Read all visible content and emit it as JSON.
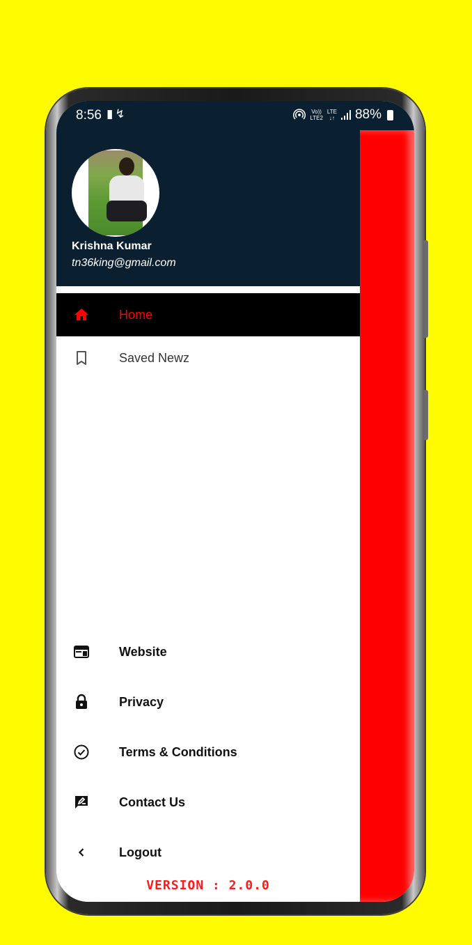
{
  "status_bar": {
    "time": "8:56",
    "left_icons": [
      "sim-icon",
      "bolt-icon"
    ],
    "volte_label_top": "Vo))",
    "volte_label_bottom": "LTE2",
    "lte_label_top": "LTE",
    "lte_label_bottom": "↓↑",
    "battery": "88%"
  },
  "profile": {
    "name": "Krishna Kumar",
    "email": "tn36king@gmail.com"
  },
  "menu": {
    "home": {
      "label": "Home",
      "icon": "home-icon"
    },
    "saved": {
      "label": "Saved Newz",
      "icon": "bookmark-icon"
    },
    "website": {
      "label": "Website",
      "icon": "web-icon"
    },
    "privacy": {
      "label": "Privacy",
      "icon": "lock-icon"
    },
    "terms": {
      "label": "Terms & Conditions",
      "icon": "check-circle-icon"
    },
    "contact": {
      "label": "Contact Us",
      "icon": "feedback-icon"
    },
    "logout": {
      "label": "Logout",
      "icon": "chevron-left-icon"
    }
  },
  "version": "VERSION : 2.0.0",
  "colors": {
    "background": "#fffb00",
    "header": "#0a1f2f",
    "accent": "#ff0000",
    "active_row": "#000000"
  }
}
